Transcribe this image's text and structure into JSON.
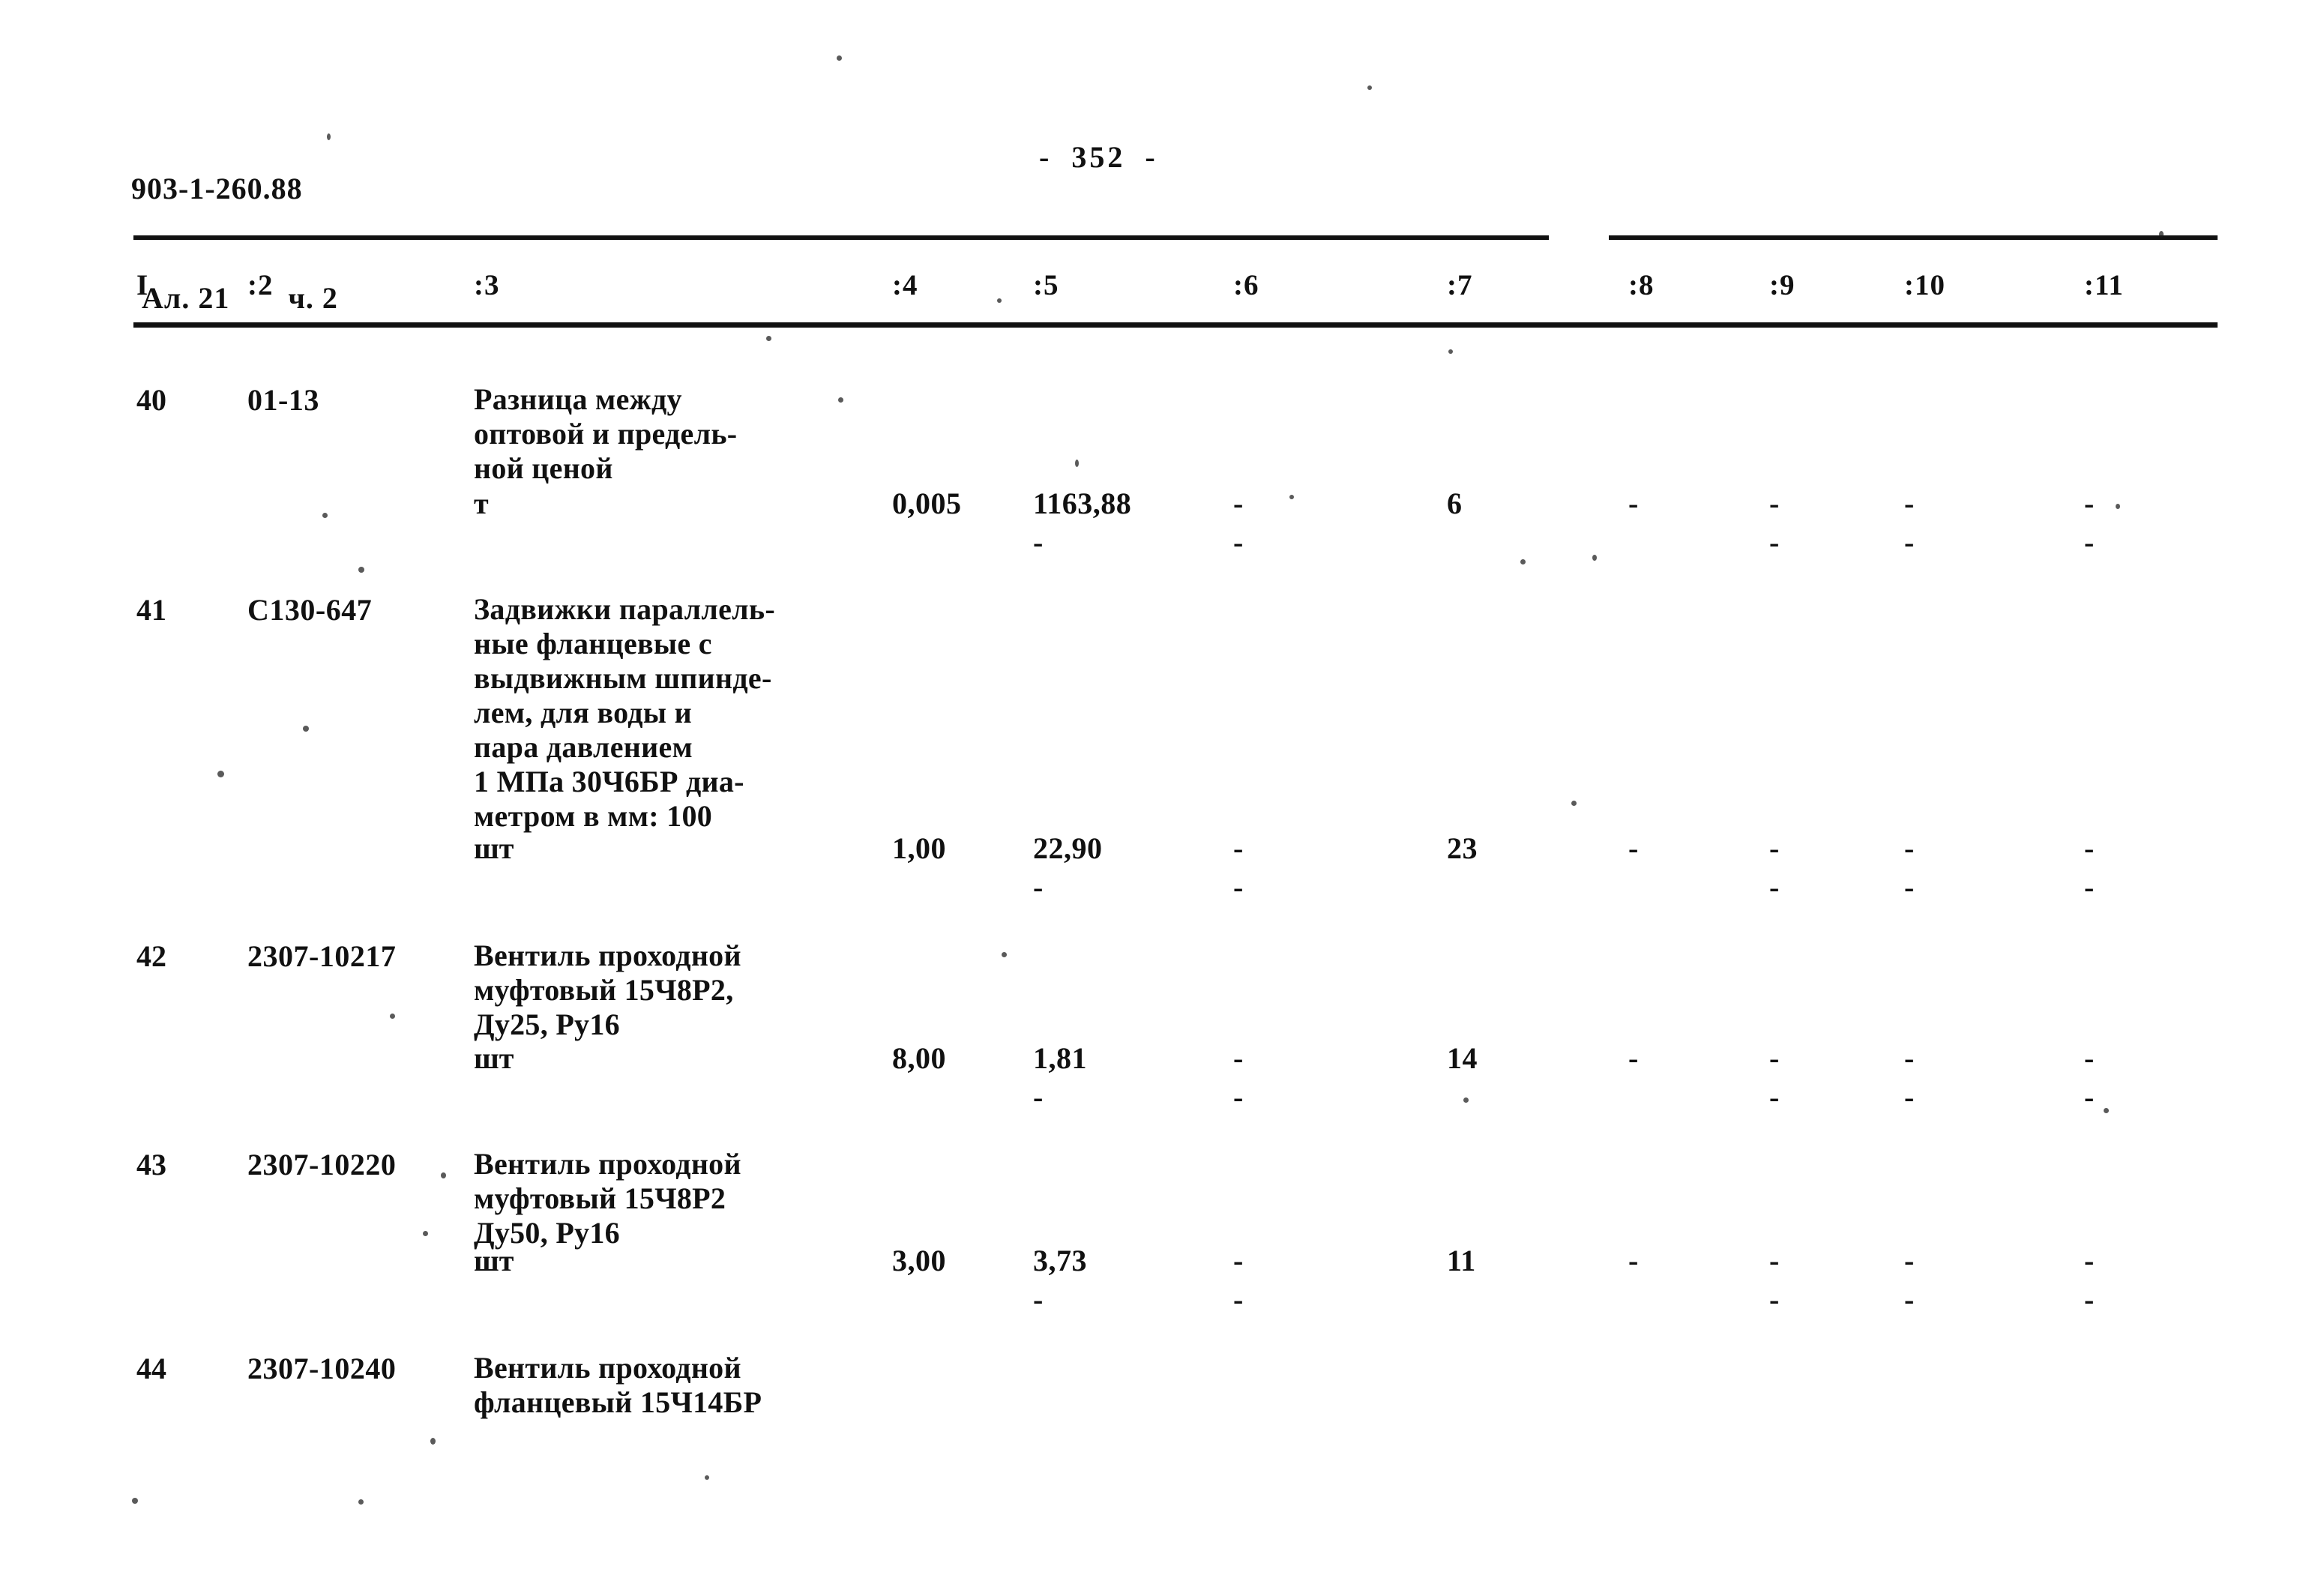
{
  "document": {
    "code": "903-1-260.88",
    "album_line": "Ал. 21",
    "part_line": "ч. 2",
    "page_dash_left": "-",
    "page_number": "352",
    "page_dash_right": "-"
  },
  "table": {
    "headers": [
      "I",
      ":2",
      ":3",
      ":4",
      ":5",
      ":6",
      ":7",
      ":8",
      ":9",
      ":10",
      ":11"
    ],
    "rows": [
      {
        "idx": "40",
        "code": "01-13",
        "desc_lines": [
          "Разница между",
          "оптовой и предель-",
          "ной ценой"
        ],
        "unit": "т",
        "c4": "0,005",
        "c5": "1163,88",
        "c6": "-",
        "c7": "6",
        "c8": "-",
        "c9": "-",
        "c10": "-",
        "c11": "-",
        "c5b": "-",
        "c6b": "-",
        "c9b": "-",
        "c10b": "-",
        "c11b": "-"
      },
      {
        "idx": "41",
        "code": "С130-647",
        "desc_lines": [
          "Задвижки параллель-",
          "ные фланцевые с",
          "выдвижным шпинде-",
          "лем, для воды и",
          "пара давлением",
          "1 МПа 30Ч6БР диа-",
          "метром в мм: 100"
        ],
        "unit": "шт",
        "c4": "1,00",
        "c5": "22,90",
        "c6": "-",
        "c7": "23",
        "c8": "-",
        "c9": "-",
        "c10": "-",
        "c11": "-",
        "c5b": "-",
        "c6b": "-",
        "c9b": "-",
        "c10b": "-",
        "c11b": "-"
      },
      {
        "idx": "42",
        "code": "2307-10217",
        "desc_lines": [
          "Вентиль проходной",
          "муфтовый 15Ч8Р2,",
          "Ду25, Ру16"
        ],
        "unit": "шт",
        "c4": "8,00",
        "c5": "1,81",
        "c6": "-",
        "c7": "14",
        "c8": "-",
        "c9": "-",
        "c10": "-",
        "c11": "-",
        "c5b": "-",
        "c6b": "-",
        "c9b": "-",
        "c10b": "-",
        "c11b": "-"
      },
      {
        "idx": "43",
        "code": "2307-10220",
        "desc_lines": [
          "Вентиль проходной",
          "муфтовый 15Ч8Р2",
          "Ду50, Ру16"
        ],
        "unit": "шт",
        "c4": "3,00",
        "c5": "3,73",
        "c6": "-",
        "c7": "11",
        "c8": "-",
        "c9": "-",
        "c10": "-",
        "c11": "-",
        "c5b": "-",
        "c6b": "-",
        "c9b": "-",
        "c10b": "-",
        "c11b": "-"
      },
      {
        "idx": "44",
        "code": "2307-10240",
        "desc_lines": [
          "Вентиль проходной",
          "фланцевый 15Ч14БР"
        ],
        "unit": "",
        "c4": "",
        "c5": "",
        "c6": "",
        "c7": "",
        "c8": "",
        "c9": "",
        "c10": "",
        "c11": "",
        "c5b": "",
        "c6b": "",
        "c9b": "",
        "c10b": "",
        "c11b": ""
      }
    ]
  }
}
